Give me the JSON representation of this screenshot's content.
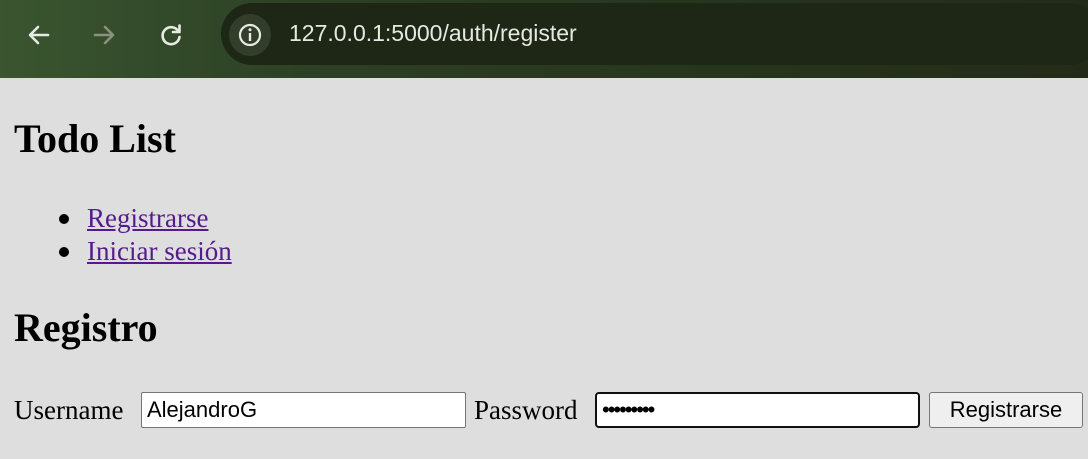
{
  "browser": {
    "url": "127.0.0.1:5000/auth/register",
    "icons": {
      "back": "arrow-left-icon",
      "forward": "arrow-right-icon",
      "reload": "reload-icon",
      "site_info": "info-icon"
    }
  },
  "page": {
    "title": "Todo List",
    "nav": [
      {
        "label": "Registrarse"
      },
      {
        "label": "Iniciar sesión"
      }
    ],
    "form_heading": "Registro",
    "form": {
      "username_label": "Username",
      "username_value": "AlejandroG",
      "password_label": "Password",
      "password_value": "•••••••••",
      "submit_label": "Registrarse"
    }
  },
  "colors": {
    "link": "#551a8b",
    "page_bg": "#dedede",
    "toolbar_bg": "#2c3f24"
  }
}
